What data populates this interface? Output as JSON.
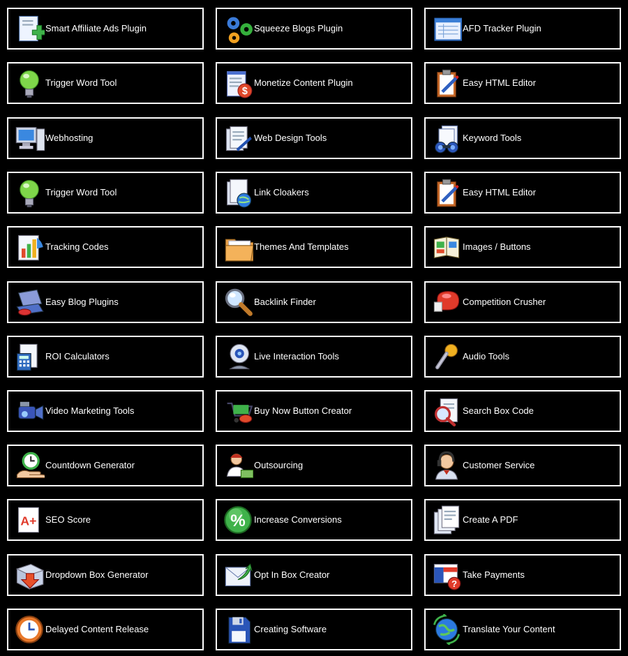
{
  "tiles": [
    {
      "label": "Smart Affiliate Ads Plugin",
      "icon": "document-plus-icon"
    },
    {
      "label": "Squeeze Blogs Plugin",
      "icon": "gears-icon"
    },
    {
      "label": "AFD Tracker Plugin",
      "icon": "spreadsheet-window-icon"
    },
    {
      "label": "Trigger Word Tool",
      "icon": "light-bulb-icon"
    },
    {
      "label": "Monetize Content Plugin",
      "icon": "notepad-dollar-icon"
    },
    {
      "label": "Easy HTML Editor",
      "icon": "clipboard-pen-icon"
    },
    {
      "label": "Webhosting",
      "icon": "computer-icon"
    },
    {
      "label": "Web Design Tools",
      "icon": "documents-pen-icon"
    },
    {
      "label": "Keyword Tools",
      "icon": "binoculars-documents-icon"
    },
    {
      "label": "Trigger Word Tool",
      "icon": "light-bulb-icon"
    },
    {
      "label": "Link Cloakers",
      "icon": "documents-globe-icon"
    },
    {
      "label": "Easy HTML Editor",
      "icon": "clipboard-pen-icon"
    },
    {
      "label": "Tracking Codes",
      "icon": "bar-chart-icon"
    },
    {
      "label": "Themes And Templates",
      "icon": "folder-icon"
    },
    {
      "label": "Images / Buttons",
      "icon": "book-images-icon"
    },
    {
      "label": "Easy Blog Plugins",
      "icon": "keyboard-book-icon"
    },
    {
      "label": "Backlink Finder",
      "icon": "magnifier-icon"
    },
    {
      "label": "Competition Crusher",
      "icon": "boxing-glove-icon"
    },
    {
      "label": "ROI Calculators",
      "icon": "calculator-document-icon"
    },
    {
      "label": "Live Interaction Tools",
      "icon": "webcam-icon"
    },
    {
      "label": "Audio Tools",
      "icon": "microphone-icon"
    },
    {
      "label": "Video Marketing Tools",
      "icon": "video-camera-icon"
    },
    {
      "label": "Buy Now Button Creator",
      "icon": "shopping-cart-mouse-icon"
    },
    {
      "label": "Search Box Code",
      "icon": "search-document-icon"
    },
    {
      "label": "Countdown Generator",
      "icon": "hand-clock-icon"
    },
    {
      "label": "Outsourcing",
      "icon": "person-money-icon"
    },
    {
      "label": "Customer Service",
      "icon": "headset-agent-icon"
    },
    {
      "label": "SEO Score",
      "icon": "a-plus-grade-icon"
    },
    {
      "label": "Increase Conversions",
      "icon": "percent-icon"
    },
    {
      "label": "Create A PDF",
      "icon": "documents-stack-icon"
    },
    {
      "label": "Dropdown Box Generator",
      "icon": "down-arrow-box-icon"
    },
    {
      "label": "Opt In Box Creator",
      "icon": "envelope-arrow-icon"
    },
    {
      "label": "Take Payments",
      "icon": "credit-card-help-icon"
    },
    {
      "label": "Delayed Content Release",
      "icon": "wall-clock-icon"
    },
    {
      "label": "Creating Software",
      "icon": "floppy-disk-icon"
    },
    {
      "label": "Translate Your Content",
      "icon": "globe-arrows-icon"
    }
  ]
}
